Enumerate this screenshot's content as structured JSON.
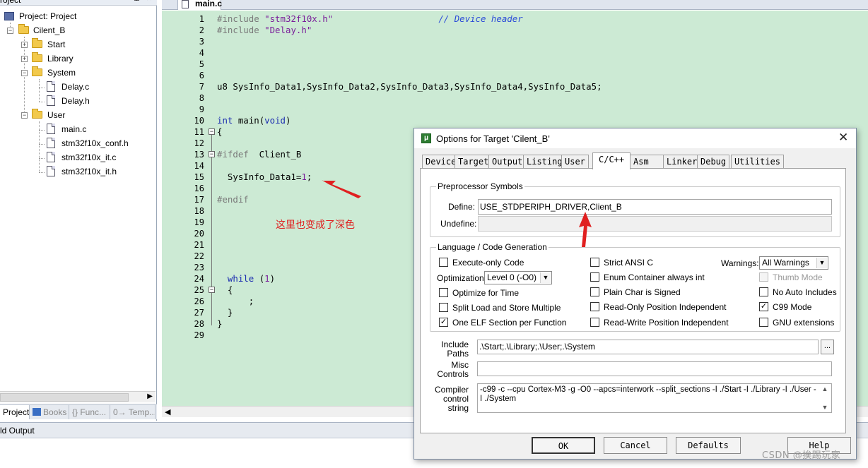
{
  "project_panel": {
    "title": "roject",
    "tree": [
      {
        "label": "Project: Project"
      },
      {
        "label": "Cilent_B"
      },
      {
        "label": "Start"
      },
      {
        "label": "Library"
      },
      {
        "label": "System"
      },
      {
        "label": "Delay.c"
      },
      {
        "label": "Delay.h"
      },
      {
        "label": "User"
      },
      {
        "label": "main.c"
      },
      {
        "label": "stm32f10x_conf.h"
      },
      {
        "label": "stm32f10x_it.c"
      },
      {
        "label": "stm32f10x_it.h"
      }
    ],
    "tabs": [
      "Project",
      "Books",
      "{} Func...",
      "0→ Temp..."
    ]
  },
  "editor": {
    "tab_label": "main.c",
    "line_numbers": [
      "1",
      "2",
      "3",
      "4",
      "5",
      "6",
      "7",
      "8",
      "9",
      "10",
      "11",
      "12",
      "13",
      "14",
      "15",
      "16",
      "17",
      "18",
      "19",
      "20",
      "21",
      "22",
      "23",
      "24",
      "25",
      "26",
      "27",
      "28",
      "29"
    ],
    "lines": {
      "l1_pp": "#include ",
      "l1_str": "\"stm32f10x.h\"",
      "l1_cmt": "// Device header",
      "l2_pp": "#include ",
      "l2_str": "\"Delay.h\"",
      "l7": "u8 SysInfo_Data1,SysInfo_Data2,SysInfo_Data3,SysInfo_Data4,SysInfo_Data5;",
      "l10_kw1": "int",
      "l10_mid": " main(",
      "l10_kw2": "void",
      "l10_end": ")",
      "l11": "{",
      "l13_pp": "#ifdef",
      "l13_rest": "  Client_B",
      "l15_a": "  SysInfo_Data1=",
      "l15_num": "1",
      "l15_b": ";",
      "l17_pp": "#endif",
      "l24_kw": "while",
      "l24_mid": " (",
      "l24_num": "1",
      "l24_end": ")",
      "l25": "  {",
      "l26": "      ;",
      "l27": "  }",
      "l28": "}"
    },
    "annotation": "这里也变成了深色"
  },
  "build_output": {
    "title": "ld Output"
  },
  "dialog": {
    "title": "Options for Target 'Cilent_B'",
    "tabs": [
      "Device",
      "Target",
      "Output",
      "Listing",
      "User",
      "C/C++",
      "Asm",
      "Linker",
      "Debug",
      "Utilities"
    ],
    "active_tab": "C/C++",
    "preprocessor": {
      "group_label": "Preprocessor Symbols",
      "define_label": "Define:",
      "define_value": "USE_STDPERIPH_DRIVER,Client_B",
      "undefine_label": "Undefine:",
      "undefine_value": ""
    },
    "codegen": {
      "group_label": "Language / Code Generation",
      "execute_only": {
        "label": "Execute-only Code",
        "checked": false
      },
      "optimization_label": "Optimization:",
      "optimization_value": "Level 0 (-O0)",
      "optimize_time": {
        "label": "Optimize for Time",
        "checked": false
      },
      "split_load": {
        "label": "Split Load and Store Multiple",
        "checked": false
      },
      "one_elf": {
        "label": "One ELF Section per Function",
        "checked": true
      },
      "strict_ansi": {
        "label": "Strict ANSI C",
        "checked": false
      },
      "enum_container": {
        "label": "Enum Container always int",
        "checked": false
      },
      "plain_char": {
        "label": "Plain Char is Signed",
        "checked": false
      },
      "ro_pi": {
        "label": "Read-Only Position Independent",
        "checked": false
      },
      "rw_pi": {
        "label": "Read-Write Position Independent",
        "checked": false
      },
      "warnings_label": "Warnings:",
      "warnings_value": "All Warnings",
      "thumb_mode": {
        "label": "Thumb Mode",
        "checked": false,
        "disabled": true
      },
      "no_auto_includes": {
        "label": "No Auto Includes",
        "checked": false
      },
      "c99_mode": {
        "label": "C99 Mode",
        "checked": true
      },
      "gnu_ext": {
        "label": "GNU extensions",
        "checked": false
      }
    },
    "include_paths_label_1": "Include",
    "include_paths_label_2": "Paths",
    "include_paths_value": ".\\Start;.\\Library;.\\User;.\\System",
    "browse_label": "...",
    "misc_label_1": "Misc",
    "misc_label_2": "Controls",
    "misc_value": "",
    "compiler_label_1": "Compiler",
    "compiler_label_2": "control",
    "compiler_label_3": "string",
    "compiler_value": "-c99 -c --cpu Cortex-M3 -g -O0 --apcs=interwork --split_sections -I ./Start -I ./Library -I ./User -I ./System",
    "buttons": {
      "ok": "OK",
      "cancel": "Cancel",
      "defaults": "Defaults",
      "help": "Help"
    }
  },
  "watermark": "CSDN @挨踢玩家",
  "colors": {
    "editor_bg": "#ccead4",
    "annotation": "#e02020",
    "keyword": "#1a2bb0",
    "string": "#7a1e9a",
    "comment": "#2b4bd8"
  }
}
